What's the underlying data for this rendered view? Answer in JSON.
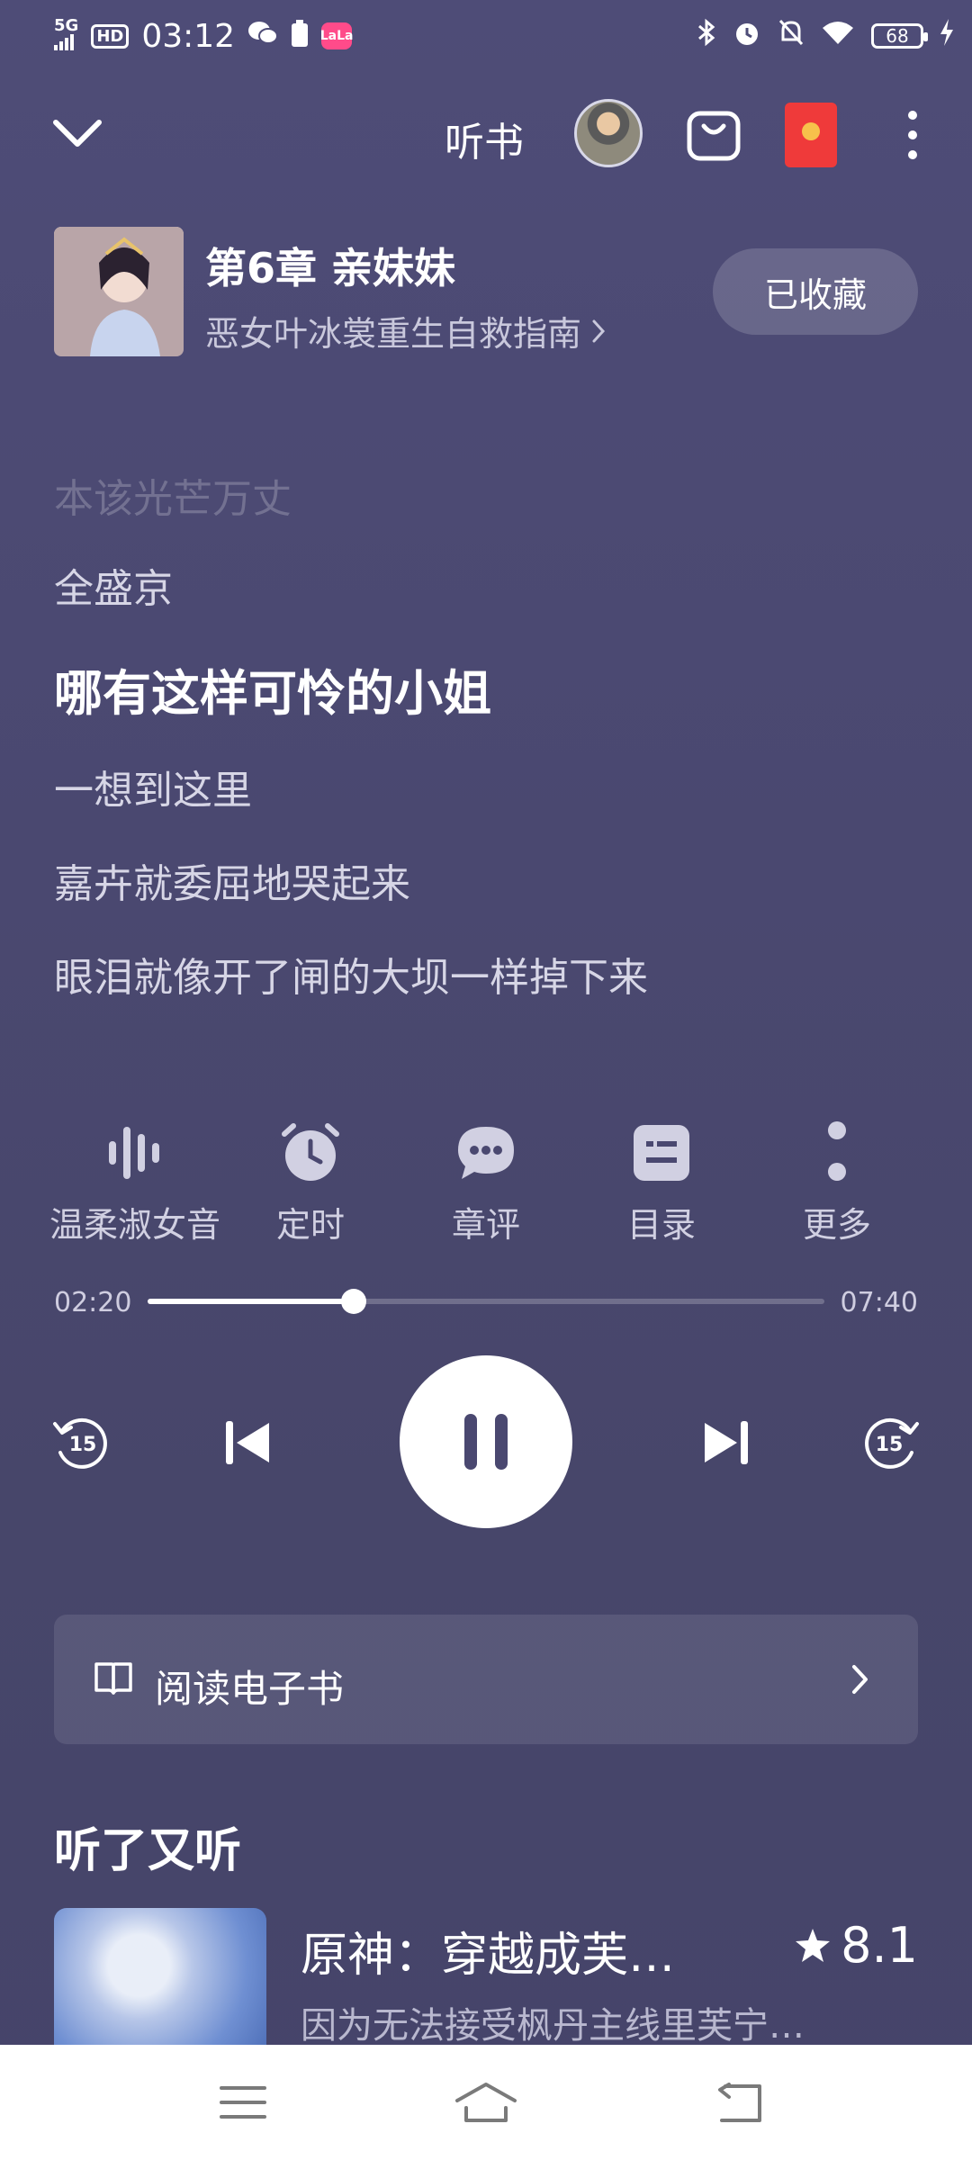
{
  "status_bar": {
    "network": "5G",
    "hd": "HD",
    "time": "03:12",
    "battery": "68",
    "app_badge": "LaLa"
  },
  "topbar": {
    "title": "听书"
  },
  "chapter": {
    "title": "第6章 亲妹妹",
    "book_name": "恶女叶冰裳重生自救指南",
    "collect_label": "已收藏"
  },
  "lyrics": [
    {
      "text": "本该光芒万丈",
      "state": "faded"
    },
    {
      "text": "全盛京",
      "state": "normal"
    },
    {
      "text": "哪有这样可怜的小姐",
      "state": "current"
    },
    {
      "text": "一想到这里",
      "state": "normal"
    },
    {
      "text": "嘉卉就委屈地哭起来",
      "state": "normal"
    },
    {
      "text": "眼泪就像开了闸的大坝一样掉下来",
      "state": "normal"
    }
  ],
  "functions": [
    {
      "label": "温柔淑女音",
      "icon": "voice-wave-icon"
    },
    {
      "label": "定时",
      "icon": "alarm-clock-icon"
    },
    {
      "label": "章评",
      "icon": "comment-bubble-icon"
    },
    {
      "label": "目录",
      "icon": "catalog-list-icon"
    },
    {
      "label": "更多",
      "icon": "more-vertical-icon"
    }
  ],
  "progress": {
    "current": "02:20",
    "total": "07:40",
    "fraction": 0.304
  },
  "controls": {
    "rewind_seconds": "15",
    "forward_seconds": "15"
  },
  "ebook": {
    "label": "阅读电子书"
  },
  "recommend": {
    "section_title": "听了又听",
    "item_title": "原神：穿越成芙…",
    "item_score": "8.1",
    "item_desc": "因为无法接受枫丹主线里芙宁…"
  },
  "colors": {
    "background": "#4a4870",
    "accent": "#ffffff",
    "red_packet": "#ef3a3a"
  }
}
